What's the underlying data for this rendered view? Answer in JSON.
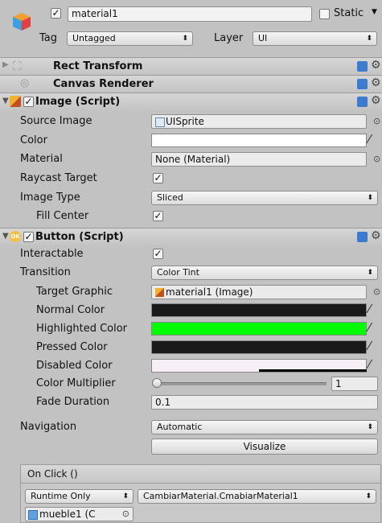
{
  "header": {
    "name_value": "material1",
    "static_label": "Static",
    "tag_label": "Tag",
    "tag_value": "Untagged",
    "layer_label": "Layer",
    "layer_value": "UI"
  },
  "rect_transform": {
    "title": "Rect Transform"
  },
  "canvas_renderer": {
    "title": "Canvas Renderer"
  },
  "image": {
    "title": "Image (Script)",
    "source_image_label": "Source Image",
    "source_image_value": "UISprite",
    "color_label": "Color",
    "material_label": "Material",
    "material_value": "None (Material)",
    "raycast_label": "Raycast Target",
    "image_type_label": "Image Type",
    "image_type_value": "Sliced",
    "fill_center_label": "Fill Center"
  },
  "button": {
    "title": "Button (Script)",
    "interactable_label": "Interactable",
    "transition_label": "Transition",
    "transition_value": "Color Tint",
    "target_graphic_label": "Target Graphic",
    "target_graphic_value": "material1 (Image)",
    "normal_color_label": "Normal Color",
    "highlighted_color_label": "Highlighted Color",
    "pressed_color_label": "Pressed Color",
    "disabled_color_label": "Disabled Color",
    "color_multiplier_label": "Color Multiplier",
    "color_multiplier_value": "1",
    "fade_duration_label": "Fade Duration",
    "fade_duration_value": "0.1",
    "navigation_label": "Navigation",
    "navigation_value": "Automatic",
    "visualize_label": "Visualize"
  },
  "on_click": {
    "title": "On Click ()",
    "runtime_value": "Runtime Only",
    "function_value": "CambiarMaterial.CmabiarMaterial1",
    "object_value": "mueble1 (C"
  },
  "colors": {
    "panel_bg": "#c2c2c2",
    "normal_color": "#1a1a1a",
    "highlighted_color": "#00ff00",
    "pressed_color": "#1a1a1a",
    "disabled_color": "#f6f0f6",
    "image_color": "#ffffff"
  }
}
